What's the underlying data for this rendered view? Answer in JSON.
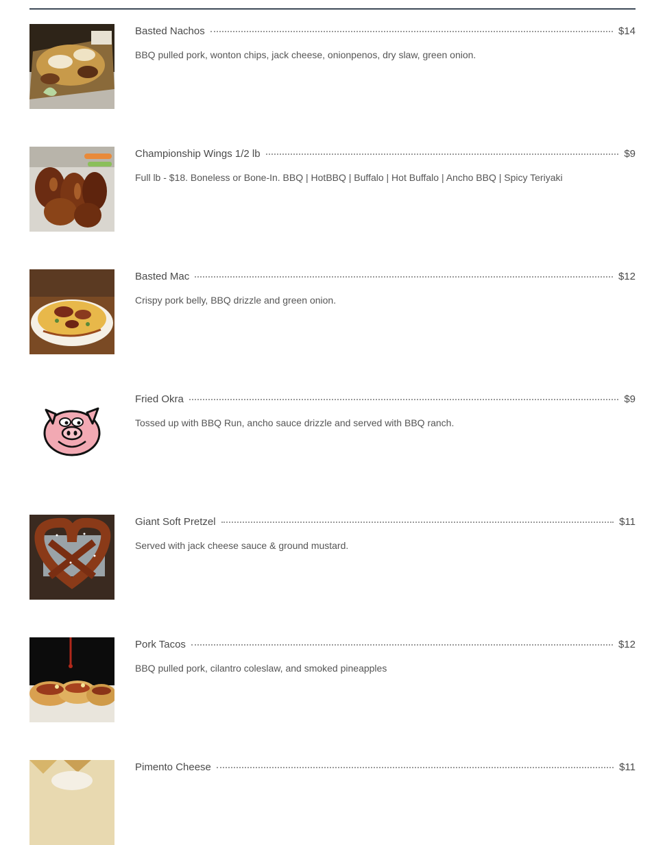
{
  "menu": {
    "items": [
      {
        "name": "Basted Nachos",
        "price": "$14",
        "description": "BBQ pulled pork, wonton chips, jack cheese, onionpenos, dry slaw, green onion.",
        "image": "nachos-photo"
      },
      {
        "name": "Championship Wings 1/2 lb",
        "price": "$9",
        "description": "Full lb - $18. Boneless or Bone-In. BBQ | HotBBQ | Buffalo | Hot Buffalo | Ancho BBQ | Spicy Teriyaki",
        "image": "wings-photo"
      },
      {
        "name": "Basted Mac",
        "price": "$12",
        "description": "Crispy pork belly, BBQ drizzle and green onion.",
        "image": "mac-photo"
      },
      {
        "name": "Fried Okra",
        "price": "$9",
        "description": "Tossed up with BBQ Run, ancho sauce drizzle and served with BBQ ranch.",
        "image": "pig-logo-icon"
      },
      {
        "name": "Giant Soft Pretzel",
        "price": "$11",
        "description": "Served with jack cheese sauce & ground mustard.",
        "image": "pretzel-photo"
      },
      {
        "name": "Pork Tacos",
        "price": "$12",
        "description": "BBQ pulled pork, cilantro coleslaw, and smoked pineapples",
        "image": "tacos-photo"
      },
      {
        "name": "Pimento Cheese",
        "price": "$11",
        "description": "",
        "image": "pimento-photo"
      }
    ]
  }
}
